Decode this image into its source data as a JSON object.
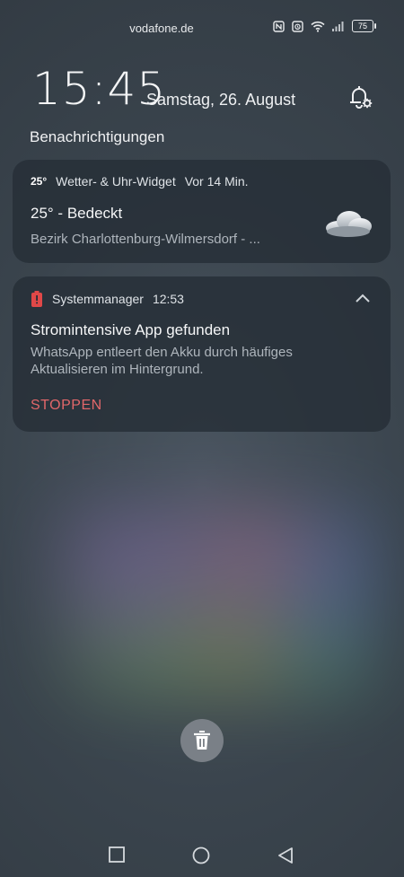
{
  "status_bar": {
    "carrier": "vodafone.de",
    "battery_level": "75",
    "icons": [
      "nfc-icon",
      "alarm-icon",
      "wifi-icon",
      "signal-icon",
      "battery-icon"
    ]
  },
  "lockscreen": {
    "time": "15:45",
    "date": "Samstag, 26. August",
    "notifications_title": "Benachrichtigungen"
  },
  "notifications": [
    {
      "app_icon_text": "25°",
      "app": "Wetter- & Uhr-Widget",
      "time": "Vor 14 Min.",
      "title": "25° -  Bedeckt",
      "subtitle": "Bezirk Charlottenburg-Wilmersdorf - ...",
      "icon": "cloud-icon"
    },
    {
      "app": "Systemmanager",
      "time": "12:53",
      "title": "Stromintensive App gefunden",
      "body_line1": "WhatsApp entleert den Akku durch häufiges",
      "body_line2": "Aktualisieren im Hintergrund.",
      "action": "STOPPEN",
      "icon": "battery-warning-icon"
    }
  ],
  "colors": {
    "action_red": "#e2676a",
    "card_bg": "#262e37",
    "battery_red": "#e04848"
  }
}
